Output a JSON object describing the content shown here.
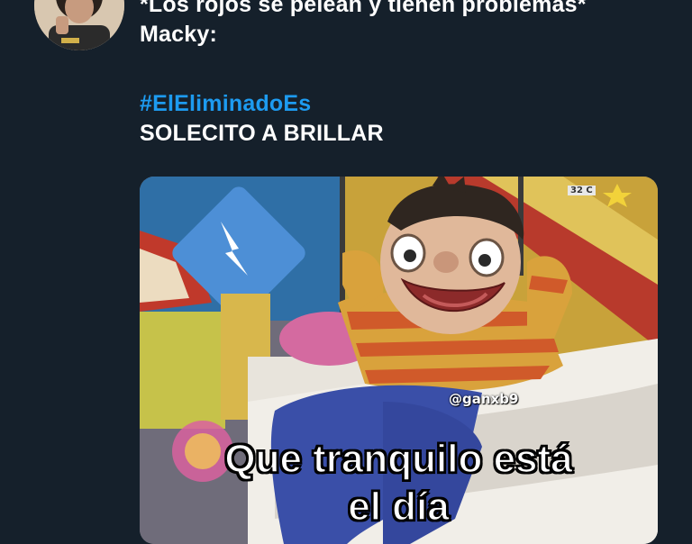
{
  "tweet": {
    "line1": "*Los rojos se pelean y tienen problemas*",
    "line2": "Macky:",
    "hashtag": "#ElEliminadoEs",
    "line4": "SOLECITO A BRILLAR"
  },
  "media": {
    "watermark": "@ganxb9",
    "caption_line1": "Que tranquilo está",
    "caption_line2": "el día",
    "tv_temperature": "32 C"
  },
  "colors": {
    "background": "#15202b",
    "text": "#ffffff",
    "hashtag": "#1d9bf0"
  }
}
